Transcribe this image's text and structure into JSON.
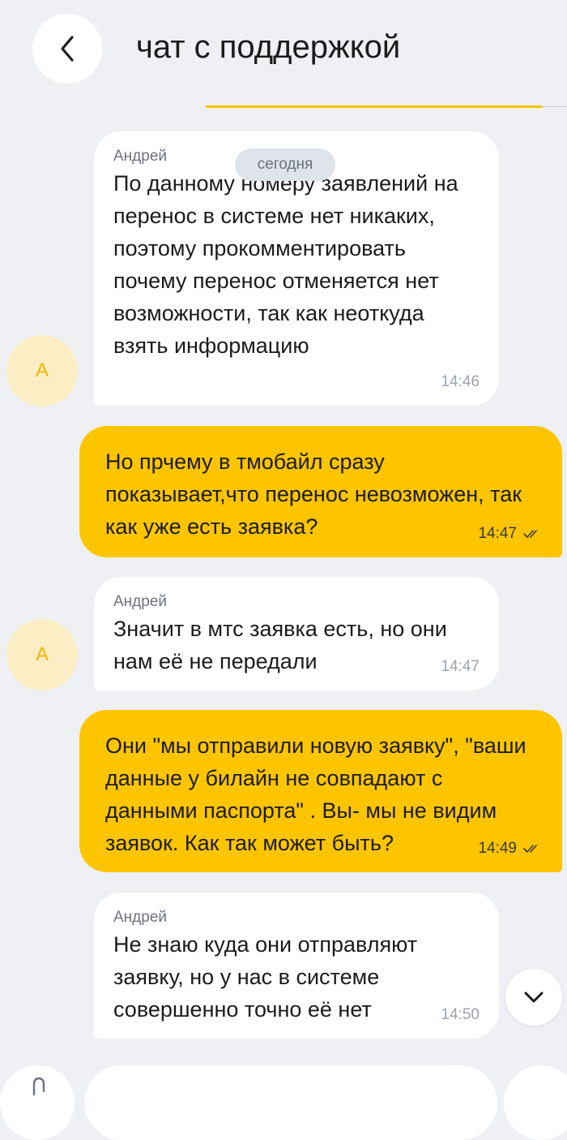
{
  "header": {
    "title": "чат с поддержкой",
    "back_icon": "chevron-left-icon"
  },
  "date_chip": "сегодня",
  "colors": {
    "background": "#eef0f3",
    "outgoing_bubble": "#fdc500",
    "incoming_bubble": "#ffffff",
    "avatar_bg": "#fbeec4",
    "avatar_text": "#f2b500",
    "accent_line": "#f5c400"
  },
  "messages": [
    {
      "direction": "in",
      "sender": "Андрей",
      "avatar": "А",
      "text": "По данному номеру заявлений на перенос в системе нет никаких, поэтому прокомментировать почему перенос отменяется нет возможности, так как неоткуда взять информацию",
      "time": "14:46"
    },
    {
      "direction": "out",
      "text": "Но прчему в тмобайл сразу показывает,что перенос невозможен, так как уже есть заявка?",
      "time": "14:47",
      "status_icon": "double-check-icon"
    },
    {
      "direction": "in",
      "sender": "Андрей",
      "avatar": "А",
      "text": "Значит в мтс заявка есть, но они нам её не передали",
      "time": "14:47"
    },
    {
      "direction": "out",
      "text": "Они \"мы отправили новую заявку\", \"ваши данные у билайн не совпадают с данными паспорта\" . Вы- мы не видим заявок. Как так может быть?",
      "time": "14:49",
      "status_icon": "double-check-icon"
    },
    {
      "direction": "in",
      "sender": "Андрей",
      "text": "Не знаю куда они отправляют заявку, но у нас в системе совершенно точно её нет",
      "time": "14:50"
    }
  ],
  "scroll_button_icon": "chevron-down-icon",
  "bottom_bar": {
    "attach_icon": "paperclip-icon"
  }
}
